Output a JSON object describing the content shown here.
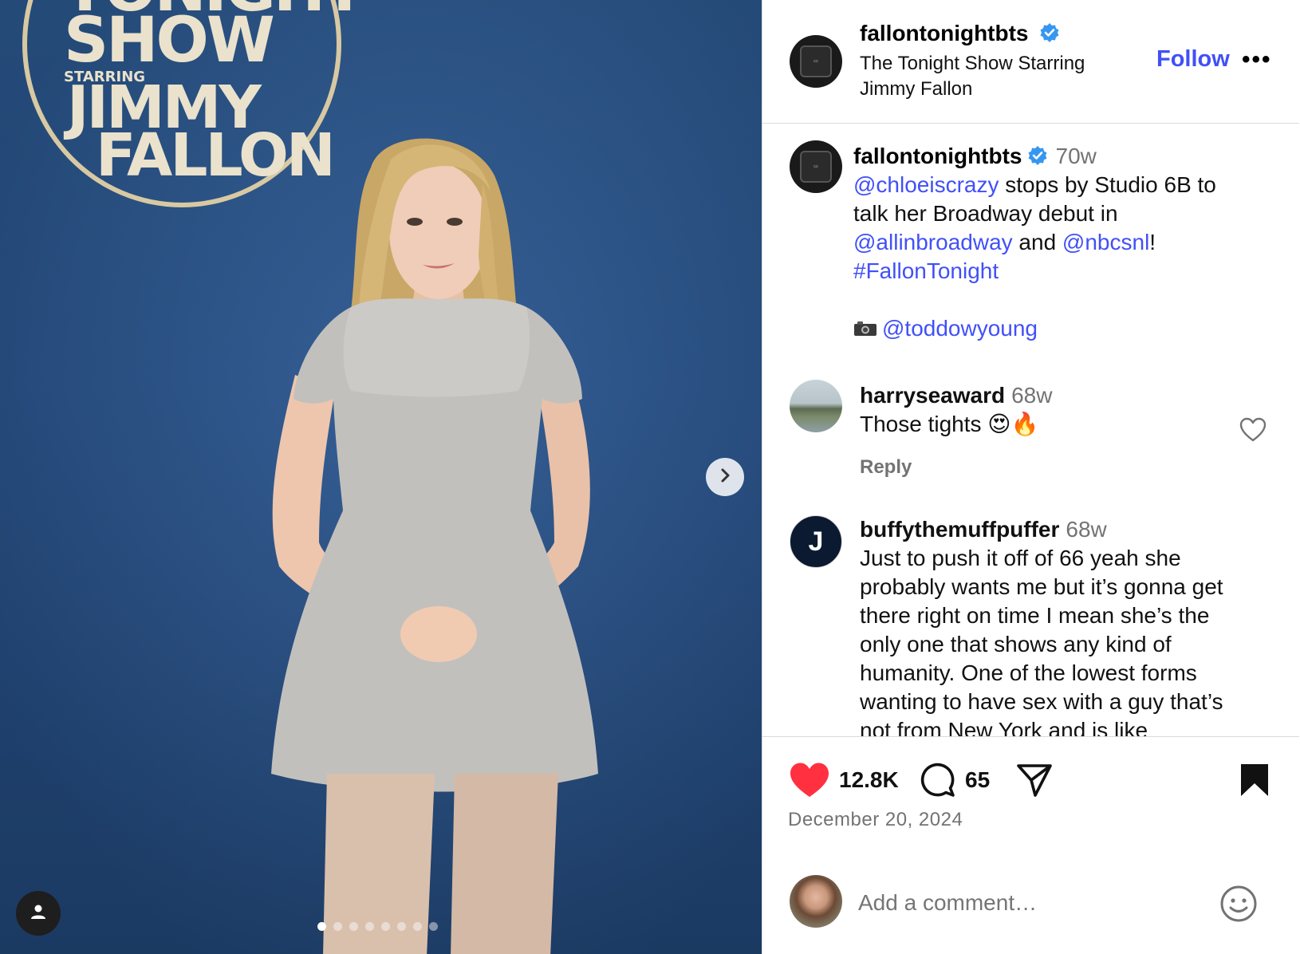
{
  "photo": {
    "logo_lines": [
      "TONIGHT",
      "SHOW",
      "STARRING",
      "JIMMY",
      "FALLON"
    ],
    "carousel_total": 8,
    "carousel_active": 1
  },
  "post": {
    "username": "fallontonightbts",
    "subtitle": "The Tonight Show Starring Jimmy Fallon",
    "follow_label": "Follow",
    "more_label": "•••",
    "caption": {
      "username": "fallontonightbts",
      "time": "70w",
      "mention1": "@chloeiscrazy",
      "text1": " stops by Studio 6B to talk her Broadway debut in ",
      "mention2": "@allinbroadway",
      "text2": " and ",
      "mention3": "@nbcsnl",
      "text3": "!",
      "hashtag": "#FallonTonight",
      "photo_credit": "@toddowyoung"
    },
    "comments": [
      {
        "username": "harryseaward",
        "time": "68w",
        "text": "Those tights 😍🔥",
        "reply_label": "Reply"
      },
      {
        "username": "buffythemuffpuffer",
        "time": "68w",
        "avatar_letter": "J",
        "text": "Just to push it off of 66 yeah she probably wants me but it’s gonna get there right on time I mean she’s the only one that shows any kind of humanity. One of the lowest forms wanting to have sex with a guy that’s not from New York and is like"
      }
    ],
    "likes": "12.8K",
    "comment_count": "65",
    "date": "December 20, 2024",
    "add_comment_placeholder": "Add a comment…"
  },
  "colors": {
    "link": "#4150f7",
    "muted": "#737373",
    "heart": "#ff3040",
    "verified": "#3797f0"
  }
}
